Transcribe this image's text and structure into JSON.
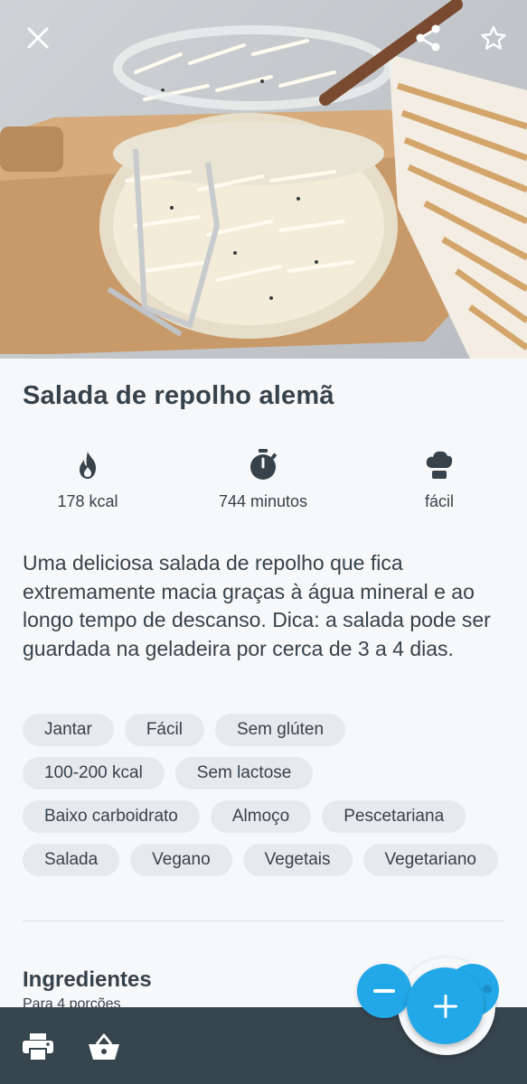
{
  "hero": {
    "close_icon": "close-icon",
    "share_icon": "share-icon",
    "favorite_icon": "star-outline-icon"
  },
  "recipe": {
    "title": "Salada de repolho alemã",
    "stats": {
      "calories": "178 kcal",
      "time": "744 minutos",
      "difficulty": "fácil"
    },
    "description": "Uma deliciosa salada de repolho que fica extremamente macia graças à água mineral e ao longo tempo de descanso. Dica: a salada pode ser guardada na geladeira por cerca de 3 a 4 dias.",
    "tags": [
      [
        "Jantar",
        "Fácil",
        "Sem glúten"
      ],
      [
        "100-200 kcal",
        "Sem lactose"
      ],
      [
        "Baixo carboidrato",
        "Almoço",
        "Pescetariana"
      ],
      [
        "Salada",
        "Vegano",
        "Vegetais",
        "Vegetariano"
      ]
    ]
  },
  "ingredients": {
    "title": "Ingredientes",
    "servings": "Para 4 porções"
  },
  "fab": {
    "minus_icon": "minus-icon",
    "plus_icon": "plus-icon"
  },
  "bottom_bar": {
    "print_icon": "printer-icon",
    "basket_icon": "basket-icon"
  },
  "colors": {
    "accent": "#22a8e8",
    "text": "#37424a",
    "bottom_bar": "#37454e",
    "chip": "#e7eaed"
  }
}
